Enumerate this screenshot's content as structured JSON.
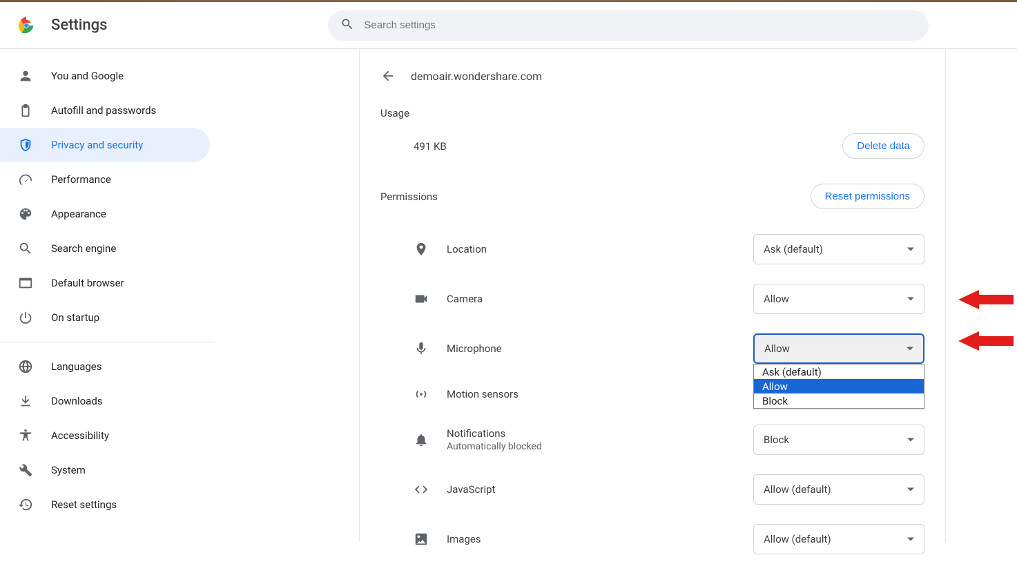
{
  "header": {
    "title": "Settings",
    "search_placeholder": "Search settings"
  },
  "sidebar": {
    "items": [
      {
        "icon": "person",
        "label": "You and Google"
      },
      {
        "icon": "clipboard",
        "label": "Autofill and passwords"
      },
      {
        "icon": "shield",
        "label": "Privacy and security",
        "active": true
      },
      {
        "icon": "gauge",
        "label": "Performance"
      },
      {
        "icon": "palette",
        "label": "Appearance"
      },
      {
        "icon": "search",
        "label": "Search engine"
      },
      {
        "icon": "window",
        "label": "Default browser"
      },
      {
        "icon": "power",
        "label": "On startup"
      }
    ],
    "items2": [
      {
        "icon": "globe",
        "label": "Languages"
      },
      {
        "icon": "download",
        "label": "Downloads"
      },
      {
        "icon": "accessibility",
        "label": "Accessibility"
      },
      {
        "icon": "wrench",
        "label": "System"
      },
      {
        "icon": "history",
        "label": "Reset settings"
      }
    ]
  },
  "page": {
    "site_url": "demoair.wondershare.com",
    "usage_title": "Usage",
    "usage_value": "491 KB",
    "delete_data_label": "Delete data",
    "permissions_title": "Permissions",
    "reset_permissions_label": "Reset permissions"
  },
  "permissions": [
    {
      "icon": "location",
      "label": "Location",
      "value": "Ask (default)"
    },
    {
      "icon": "camera",
      "label": "Camera",
      "value": "Allow"
    },
    {
      "icon": "microphone",
      "label": "Microphone",
      "value": "Allow",
      "focused": true
    },
    {
      "icon": "motion",
      "label": "Motion sensors",
      "value": ""
    },
    {
      "icon": "bell",
      "label": "Notifications",
      "sublabel": "Automatically blocked",
      "value": "Block"
    },
    {
      "icon": "code",
      "label": "JavaScript",
      "value": "Allow (default)"
    },
    {
      "icon": "image",
      "label": "Images",
      "value": "Allow (default)"
    }
  ],
  "dropdown_options": {
    "opt0": "Ask (default)",
    "opt1": "Allow",
    "opt2": "Block"
  }
}
